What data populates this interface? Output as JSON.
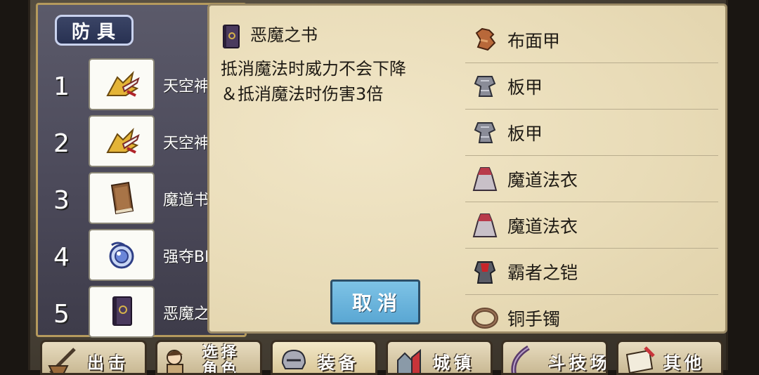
{
  "section_tab": "防具",
  "slots": [
    {
      "num": "1",
      "name": "天空神",
      "icon": "golden-winged-boots-icon"
    },
    {
      "num": "2",
      "name": "天空神",
      "icon": "golden-winged-boots-icon"
    },
    {
      "num": "3",
      "name": "魔道书",
      "icon": "brown-book-icon"
    },
    {
      "num": "4",
      "name": "强夺BI",
      "icon": "blue-amulet-icon"
    },
    {
      "num": "5",
      "name": "恶魔之",
      "icon": "demon-book-icon"
    }
  ],
  "popup": {
    "item_title": "恶魔之书",
    "item_icon": "demon-book-icon",
    "description_line1": "抵消魔法时威力不会下降",
    "description_line2": "＆抵消魔法时伤害3倍",
    "cancel_label": "取消"
  },
  "equipment_list": [
    {
      "label": "布面甲",
      "icon": "cloth-armor-icon"
    },
    {
      "label": "板甲",
      "icon": "plate-armor-icon"
    },
    {
      "label": "板甲",
      "icon": "plate-armor-icon"
    },
    {
      "label": "魔道法衣",
      "icon": "magic-robe-icon"
    },
    {
      "label": "魔道法衣",
      "icon": "magic-robe-icon"
    },
    {
      "label": "霸者之铠",
      "icon": "overlord-armor-icon"
    },
    {
      "label": "铜手镯",
      "icon": "bronze-bracelet-icon"
    }
  ],
  "bottom_nav": [
    {
      "label": "出击",
      "icon": "sword-ship-icon"
    },
    {
      "label": "选择角色",
      "icon": "character-select-icon"
    },
    {
      "label": "装备",
      "icon": "equipment-helmet-icon"
    },
    {
      "label": "城镇",
      "icon": "town-icon"
    },
    {
      "label": "斗技场",
      "icon": "arena-blade-icon"
    },
    {
      "label": "其他",
      "icon": "other-scroll-icon"
    }
  ],
  "colors": {
    "popup_bg": "#ece0bf",
    "cancel_button": "#6cb6de",
    "panel_border": "#b59a5d",
    "tab_bg": "#2f3a5c"
  }
}
